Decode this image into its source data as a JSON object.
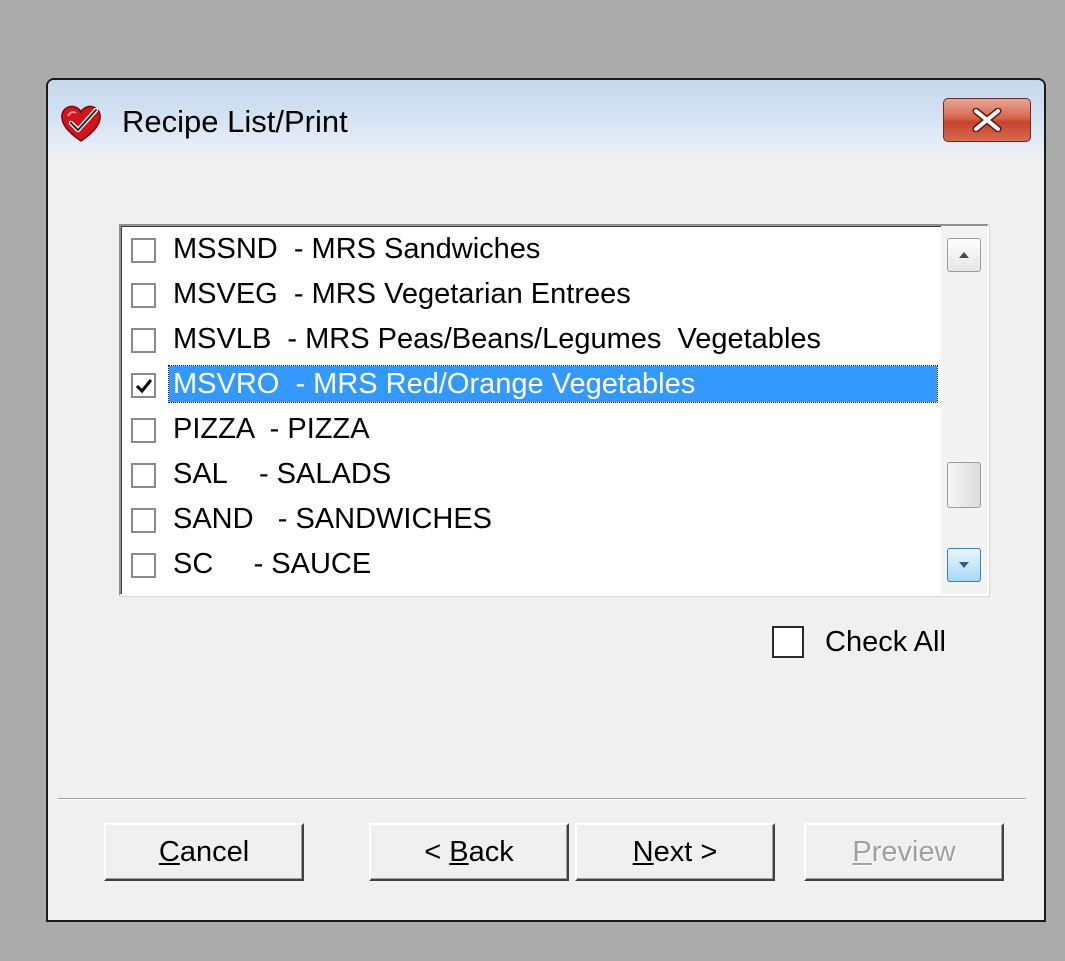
{
  "window": {
    "title": "Recipe List/Print",
    "app_icon": "heart-check-icon",
    "close_icon": "close-icon"
  },
  "recipe_list": {
    "items": [
      {
        "label": "MSSND  - MRS Sandwiches",
        "checked": false,
        "selected": false
      },
      {
        "label": "MSVEG  - MRS Vegetarian Entrees",
        "checked": false,
        "selected": false
      },
      {
        "label": "MSVLB  - MRS Peas/Beans/Legumes  Vegetables",
        "checked": false,
        "selected": false
      },
      {
        "label": "MSVRO  - MRS Red/Orange Vegetables",
        "checked": true,
        "selected": true
      },
      {
        "label": "PIZZA  - PIZZA",
        "checked": false,
        "selected": false
      },
      {
        "label": "SAL    - SALADS",
        "checked": false,
        "selected": false
      },
      {
        "label": "SAND   - SANDWICHES",
        "checked": false,
        "selected": false
      },
      {
        "label": "SC     - SAUCE",
        "checked": false,
        "selected": false
      }
    ],
    "scroll_icons": [
      "scroll-up-icon",
      "scroll-down-icon"
    ]
  },
  "check_all": {
    "label": "Check All",
    "checked": false
  },
  "buttons": {
    "cancel": {
      "mnemonic": "C",
      "rest": "ancel",
      "enabled": true
    },
    "back": {
      "prefix": "< ",
      "mnemonic": "B",
      "rest": "ack",
      "enabled": true
    },
    "next": {
      "mnemonic": "N",
      "rest": "ext >",
      "enabled": true
    },
    "preview": {
      "mnemonic": "P",
      "rest": "review",
      "enabled": false
    }
  },
  "colors": {
    "selection": "#3399ff",
    "close_button": "#c7432b",
    "desktop": "#ababab",
    "dialog": "#f0f0f0"
  }
}
